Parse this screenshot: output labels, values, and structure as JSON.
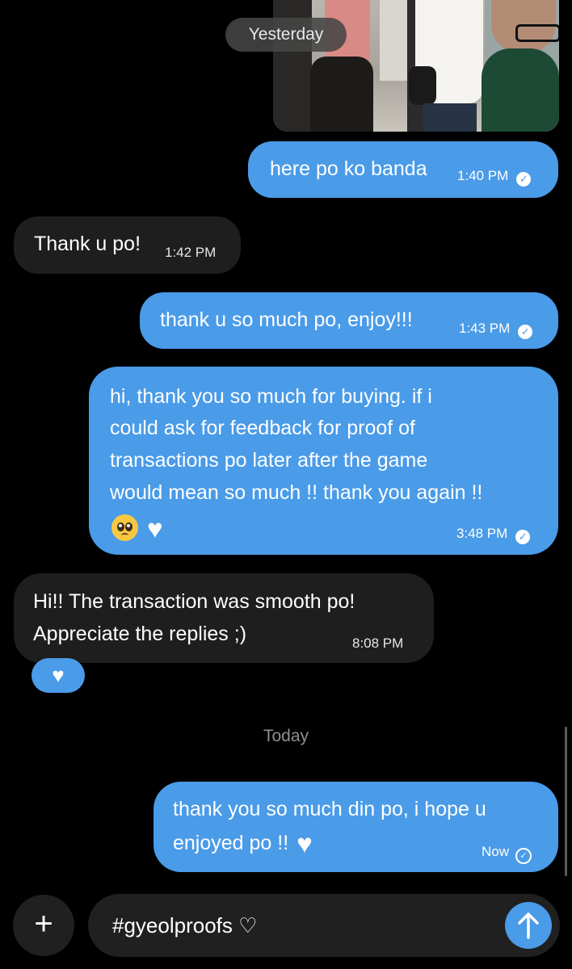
{
  "header": {
    "date_divider": "Yesterday"
  },
  "messages": [
    {
      "direction": "out",
      "lines": [
        "here po ko banda"
      ],
      "time": "1:40 PM",
      "status": "read"
    },
    {
      "direction": "in",
      "lines": [
        "Thank u po!"
      ],
      "time": "1:42 PM"
    },
    {
      "direction": "out",
      "lines": [
        "thank u so much po, enjoy!!!"
      ],
      "time": "1:43 PM",
      "status": "read"
    },
    {
      "direction": "out",
      "lines": [
        "hi, thank you so much for buying. if i",
        "could ask for feedback for proof of",
        "transactions po later after the game",
        "would mean so much !! thank you again !!"
      ],
      "emojis": [
        "pleading-face",
        "white-heart"
      ],
      "time": "3:48 PM",
      "status": "read"
    },
    {
      "direction": "in",
      "lines": [
        "Hi!! The transaction was smooth po!",
        "Appreciate the replies ;)"
      ],
      "time": "8:08 PM",
      "reaction": "white-heart"
    },
    {
      "direction": "out",
      "lines": [
        "thank you so much din po, i hope u",
        "enjoyed po !!"
      ],
      "emojis": [
        "white-heart"
      ],
      "time": "Now",
      "status": "sent"
    }
  ],
  "today_divider": "Today",
  "composer": {
    "text": "#gyeolproofs ♡"
  },
  "icons": {
    "plus": "plus-icon",
    "send": "send-arrow-icon",
    "read": "read-check-icon",
    "sent": "sent-check-icon",
    "heart": "white-heart-icon"
  },
  "colors": {
    "outgoing_bubble": "#4a9be8",
    "incoming_bubble": "#1e1e1e",
    "background": "#000000"
  }
}
